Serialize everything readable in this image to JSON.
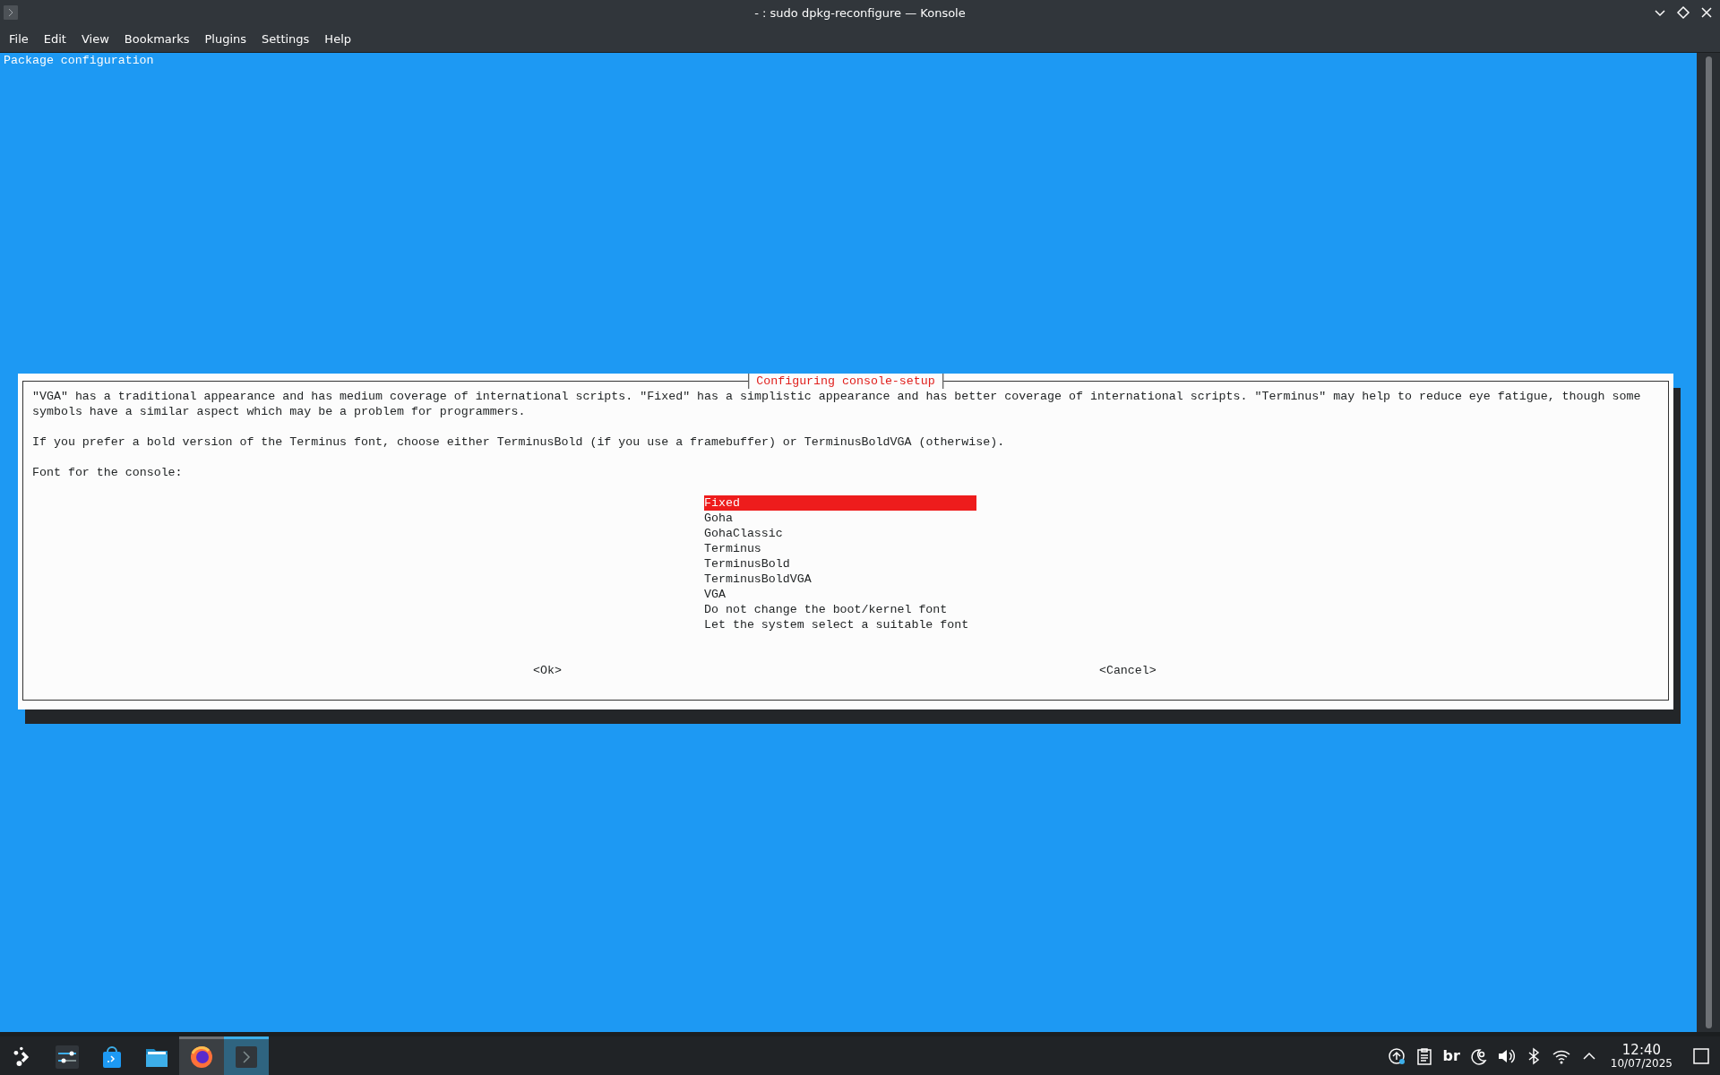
{
  "window": {
    "title": "- : sudo dpkg-reconfigure — Konsole"
  },
  "menu": [
    {
      "label": "File"
    },
    {
      "label": "Edit"
    },
    {
      "label": "View"
    },
    {
      "label": "Bookmarks"
    },
    {
      "label": "Plugins"
    },
    {
      "label": "Settings"
    },
    {
      "label": "Help"
    }
  ],
  "terminal": {
    "header": "Package configuration",
    "dialog": {
      "title": "Configuring console-setup",
      "description_lines": [
        "\"VGA\" has a traditional appearance and has medium coverage of international scripts. \"Fixed\" has a simplistic appearance and has better coverage of international scripts. \"Terminus\" may help to reduce eye fatigue, though some",
        "symbols have a similar aspect which may be a problem for programmers."
      ],
      "hint": "If you prefer a bold version of the Terminus font, choose either TerminusBold (if you use a framebuffer) or TerminusBoldVGA (otherwise).",
      "prompt": "Font for the console:",
      "options": [
        {
          "label": "Fixed",
          "selected": true
        },
        {
          "label": "Goha",
          "selected": false
        },
        {
          "label": "GohaClassic",
          "selected": false
        },
        {
          "label": "Terminus",
          "selected": false
        },
        {
          "label": "TerminusBold",
          "selected": false
        },
        {
          "label": "TerminusBoldVGA",
          "selected": false
        },
        {
          "label": "VGA",
          "selected": false
        },
        {
          "label": "Do not change the boot/kernel font",
          "selected": false
        },
        {
          "label": "Let the system select a suitable font",
          "selected": false
        }
      ],
      "buttons": [
        "<Ok>",
        "<Cancel>"
      ]
    }
  },
  "taskbar": {
    "apps": [
      {
        "kind": "launcher",
        "running": false,
        "active": false
      },
      {
        "kind": "settings",
        "running": false,
        "active": false
      },
      {
        "kind": "store",
        "running": false,
        "active": false
      },
      {
        "kind": "folder",
        "running": false,
        "active": false
      },
      {
        "kind": "browser",
        "running": true,
        "active": false
      },
      {
        "kind": "terminal",
        "running": true,
        "active": true
      }
    ],
    "tray": [
      {
        "kind": "update"
      },
      {
        "kind": "clipboard"
      },
      {
        "kind": "layout",
        "label": "br"
      },
      {
        "kind": "night"
      },
      {
        "kind": "volume"
      },
      {
        "kind": "bluetooth"
      },
      {
        "kind": "wifi"
      },
      {
        "kind": "expand"
      }
    ],
    "time": "12:40",
    "date": "10/07/2025"
  }
}
